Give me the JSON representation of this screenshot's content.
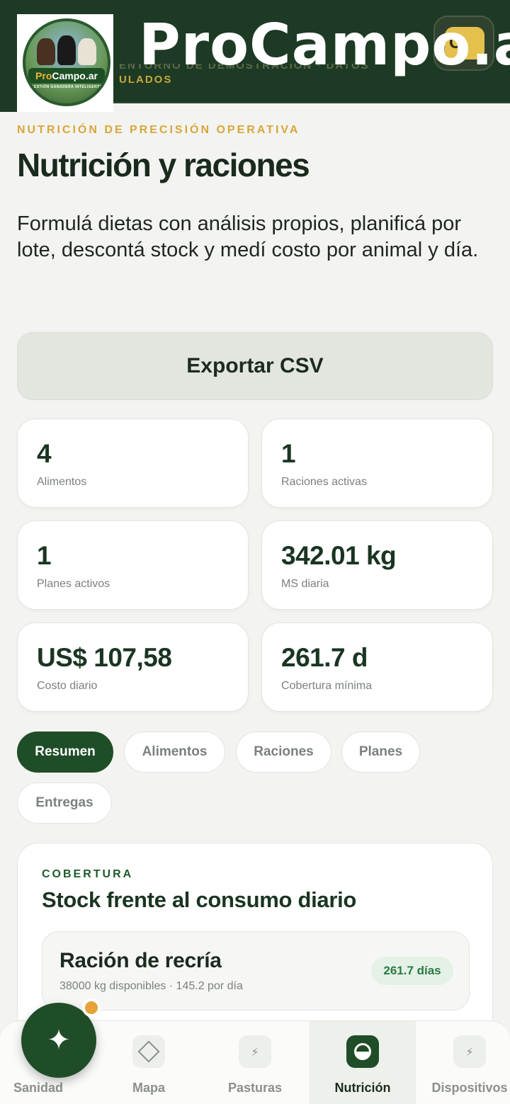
{
  "header": {
    "brand": "ProCampo.ar",
    "subtitle_hidden": "ENTORNO DE DEMOSTRACIÓN · DATOS",
    "subtitle_visible": "ULADOS",
    "avatar_letter": "C",
    "logo": {
      "name": "ProCampo.ar",
      "name_pro": "Pro",
      "name_rest": "Campo.ar",
      "tagline": "GESTIÓN GANADERA INTELIGENTE"
    }
  },
  "page": {
    "eyebrow": "NUTRICIÓN DE PRECISIÓN OPERATIVA",
    "title": "Nutrición y raciones",
    "description": "Formulá dietas con análisis propios, planificá por lote, descontá stock y medí costo por animal y día.",
    "export_label": "Exportar CSV"
  },
  "stats": [
    {
      "value": "4",
      "label": "Alimentos"
    },
    {
      "value": "1",
      "label": "Raciones activas"
    },
    {
      "value": "1",
      "label": "Planes activos"
    },
    {
      "value": "342.01 kg",
      "label": "MS diaria"
    },
    {
      "value": "US$ 107,58",
      "label": "Costo diario"
    },
    {
      "value": "261.7 d",
      "label": "Cobertura mínima"
    }
  ],
  "tabs": [
    "Resumen",
    "Alimentos",
    "Raciones",
    "Planes",
    "Entregas"
  ],
  "active_tab": "Resumen",
  "coverage": {
    "kicker": "COBERTURA",
    "title": "Stock frente al consumo diario",
    "items": [
      {
        "name": "Ración de recría",
        "meta": "38000 kg disponibles · 145.2 por día",
        "badge": "261.7 días"
      }
    ]
  },
  "nav": {
    "items": [
      {
        "label": "Sanidad",
        "icon": "sparkle-icon"
      },
      {
        "label": "Mapa",
        "icon": "diamond-icon"
      },
      {
        "label": "Pasturas",
        "icon": "bolt-icon"
      },
      {
        "label": "Nutrición",
        "icon": "half-circle-icon"
      },
      {
        "label": "Dispositivos",
        "icon": "bolt-icon"
      }
    ],
    "active": "Nutrición"
  },
  "colors": {
    "primary": "#1f4d27",
    "accent": "#d9a63b",
    "header_bg": "#1d3a24",
    "badge_bg": "#e4f1e6"
  }
}
